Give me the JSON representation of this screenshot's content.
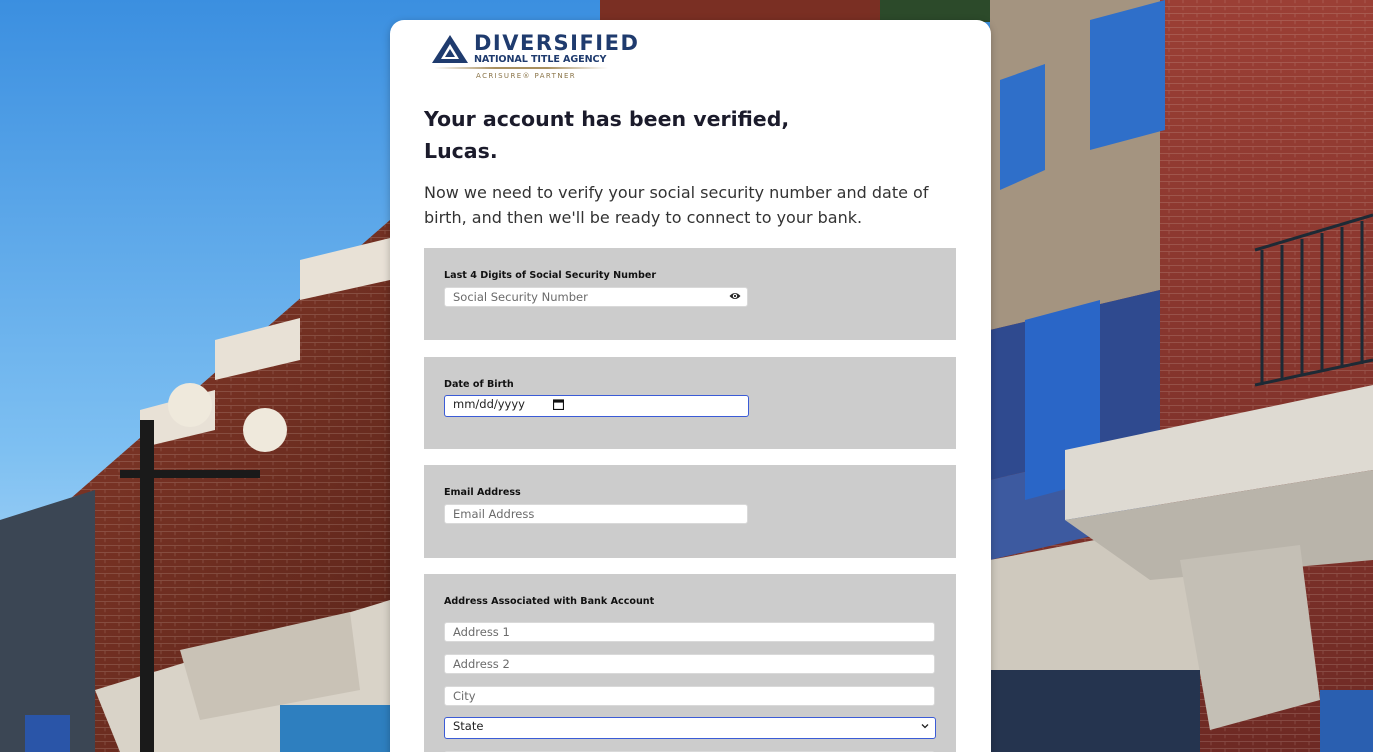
{
  "brand": {
    "name_line1": "DIVERSIFIED",
    "name_line2": "NATIONAL TITLE AGENCY",
    "tagline": "ACRISURE® PARTNER",
    "primary_color": "#1f3b6e",
    "accent_color": "#a88f5e"
  },
  "headline": {
    "line1": "Your account has been verified,",
    "line2": "Lucas."
  },
  "intro": "Now we need to verify your social security number and date of birth, and then we'll be ready to connect to your bank.",
  "ssn_section": {
    "label": "Last 4 Digits of Social Security Number",
    "placeholder": "Social Security Number",
    "icon": "eye-icon"
  },
  "dob_section": {
    "label": "Date of Birth",
    "placeholder": "mm/dd/yyyy",
    "icon": "calendar-icon"
  },
  "email_section": {
    "label": "Email Address",
    "placeholder": "Email Address"
  },
  "address_section": {
    "label": "Address Associated with Bank Account",
    "address1_placeholder": "Address 1",
    "address2_placeholder": "Address 2",
    "city_placeholder": "City",
    "state_selected": "State"
  },
  "colors": {
    "section_bg": "#cccccc",
    "focus_border": "#3b5bd6"
  }
}
